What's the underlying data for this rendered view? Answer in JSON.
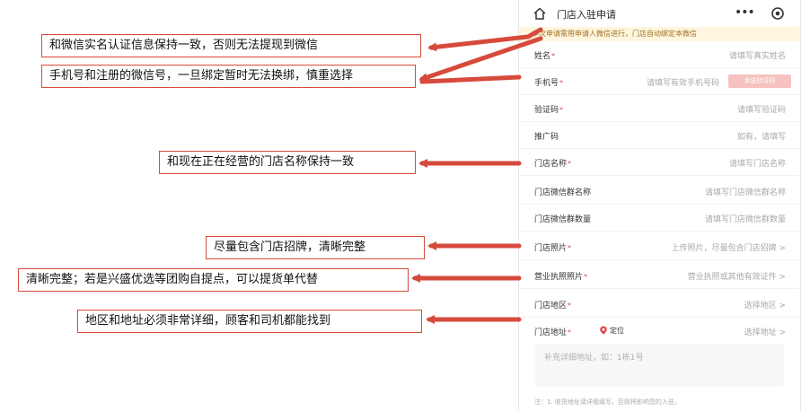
{
  "header": {
    "title": "门店入驻申请",
    "more": "•••"
  },
  "notice": "本次申请需用申请人微信进行，门店自动绑定本微信",
  "form": {
    "name": {
      "label": "姓名",
      "placeholder": "请填写真实姓名"
    },
    "phone": {
      "label": "手机号",
      "placeholder": "请填写有效手机号码",
      "code_button": "发送验证码"
    },
    "code": {
      "label": "验证码",
      "placeholder": "请填写验证码"
    },
    "referral": {
      "label": "推广码",
      "placeholder": "如有，请填写"
    },
    "store_name": {
      "label": "门店名称",
      "placeholder": "请填写门店名称"
    },
    "wechat_group_name": {
      "label": "门店微信群名称",
      "placeholder": "请填写门店微信群名称"
    },
    "wechat_group_size": {
      "label": "门店微信群数量",
      "placeholder": "请填写门店微信群数量"
    },
    "store_photo": {
      "label": "门店照片",
      "placeholder": "上传照片，尽量包含门店招牌 >"
    },
    "license_photo": {
      "label": "营业执照照片",
      "placeholder": "营业执照或其他有效证件 >"
    },
    "region": {
      "label": "门店地区",
      "placeholder": "选择地区 >"
    },
    "address": {
      "label": "门店地址",
      "locate": "定位",
      "placeholder": "选择地址 >"
    },
    "detail_address_placeholder": "补充详细地址，如：1栋1号",
    "footnote": "注：1. 收货地址请详细填写，否则将影响您的入驻。"
  },
  "required_mark": "*",
  "annotations": [
    "和微信实名认证信息保持一致，否则无法提现到微信",
    "手机号和注册的微信号，一旦绑定暂时无法换绑，慎重选择",
    "和现在正在经营的门店名称保持一致",
    "尽量包含门店招牌，清晰完整",
    "清晰完整；若是兴盛优选等团购自提点，可以提货单代替",
    "地区和地址必须非常详细，顾客和司机都能找到"
  ],
  "colors": {
    "accent_red": "#d64a3c",
    "notice_bg": "#fff6df",
    "code_button_bg": "#f5c2c0"
  }
}
